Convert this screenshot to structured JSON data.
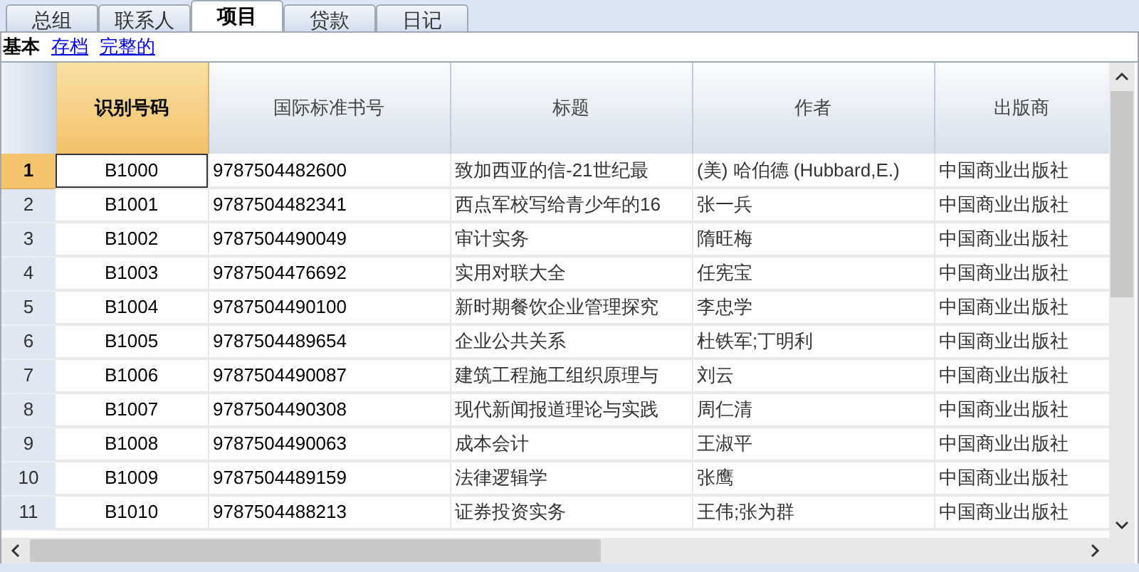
{
  "tabs": [
    {
      "label": "总组",
      "selected": false
    },
    {
      "label": "联系人",
      "selected": false
    },
    {
      "label": "项目",
      "selected": true
    },
    {
      "label": "贷款",
      "selected": false
    },
    {
      "label": "日记",
      "selected": false
    }
  ],
  "views": [
    {
      "label": "基本",
      "selected": true
    },
    {
      "label": "存档",
      "selected": false
    },
    {
      "label": "完整的",
      "selected": false
    }
  ],
  "table": {
    "columns": [
      {
        "label": "识别号码",
        "selected": true
      },
      {
        "label": "国际标准书号",
        "selected": false
      },
      {
        "label": "标题",
        "selected": false
      },
      {
        "label": "作者",
        "selected": false
      },
      {
        "label": "出版商",
        "selected": false
      }
    ],
    "rows": [
      {
        "number": "1",
        "selected": true,
        "cells": [
          "B1000",
          "9787504482600",
          "致加西亚的信-21世纪最",
          "(美) 哈伯德 (Hubbard,E.)",
          "中国商业出版社"
        ]
      },
      {
        "number": "2",
        "selected": false,
        "cells": [
          "B1001",
          "9787504482341",
          "西点军校写给青少年的16",
          "张一兵",
          "中国商业出版社"
        ]
      },
      {
        "number": "3",
        "selected": false,
        "cells": [
          "B1002",
          "9787504490049",
          "审计实务",
          "隋旺梅",
          "中国商业出版社"
        ]
      },
      {
        "number": "4",
        "selected": false,
        "cells": [
          "B1003",
          "9787504476692",
          "实用对联大全",
          "任宪宝",
          "中国商业出版社"
        ]
      },
      {
        "number": "5",
        "selected": false,
        "cells": [
          "B1004",
          "9787504490100",
          "新时期餐饮企业管理探究",
          "李忠学",
          "中国商业出版社"
        ]
      },
      {
        "number": "6",
        "selected": false,
        "cells": [
          "B1005",
          "9787504489654",
          "企业公共关系",
          "杜铁军;丁明利",
          "中国商业出版社"
        ]
      },
      {
        "number": "7",
        "selected": false,
        "cells": [
          "B1006",
          "9787504490087",
          "建筑工程施工组织原理与",
          "刘云",
          "中国商业出版社"
        ]
      },
      {
        "number": "8",
        "selected": false,
        "cells": [
          "B1007",
          "9787504490308",
          "现代新闻报道理论与实践",
          "周仁清",
          "中国商业出版社"
        ]
      },
      {
        "number": "9",
        "selected": false,
        "cells": [
          "B1008",
          "9787504490063",
          "成本会计",
          "王淑平",
          "中国商业出版社"
        ]
      },
      {
        "number": "10",
        "selected": false,
        "cells": [
          "B1009",
          "9787504489159",
          "法律逻辑学",
          "张鹰",
          "中国商业出版社"
        ]
      },
      {
        "number": "11",
        "selected": false,
        "cells": [
          "B1010",
          "9787504488213",
          "证券投资实务",
          "王伟;张为群",
          "中国商业出版社"
        ]
      }
    ]
  }
}
